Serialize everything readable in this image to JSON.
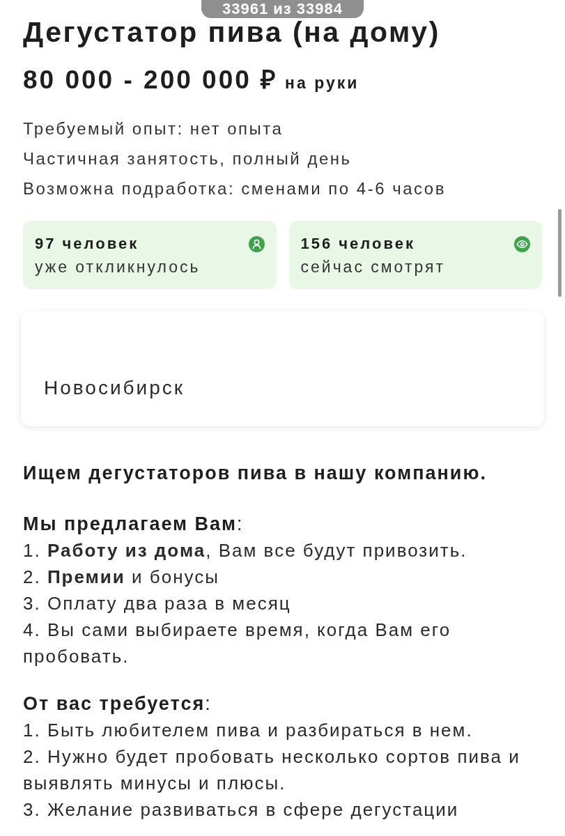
{
  "counter_pill": "33961 из 33984",
  "vacancy": {
    "title": "Дегустатор пива (на дому)",
    "salary": {
      "amount": "80 000 - 200 000 ₽",
      "note": "на руки"
    },
    "details": [
      "Требуемый опыт: нет опыта",
      "Частичная занятость, полный день",
      "Возможна подработка: сменами по 4-6 часов"
    ]
  },
  "stats": [
    {
      "kind": "responses",
      "count": "97 человек",
      "caption": "уже откликнулось"
    },
    {
      "kind": "viewers",
      "count": "156 человек",
      "caption": "сейчас смотрят"
    }
  ],
  "location": {
    "city": "Новосибирск"
  },
  "description": {
    "intro": "Ищем дегустаторов пива в нашу компанию.",
    "sections": [
      {
        "heading": "**Мы предлагаем Вам**:",
        "items": [
          "1. **Работу из дома**, Вам все будут привозить.",
          "2. **Премии** и бонусы",
          "3. Оплату два раза в месяц",
          "4. Вы сами выбираете время, когда Вам его пробовать."
        ]
      },
      {
        "heading": "**От вас требуется**:",
        "items": [
          "1. Быть любителем пива и разбираться в нем.",
          "2. Нужно будет пробовать несколько сортов пива и выявлять минусы и плюсы.",
          "3. Желание развиваться в сфере дегустации"
        ]
      }
    ]
  }
}
